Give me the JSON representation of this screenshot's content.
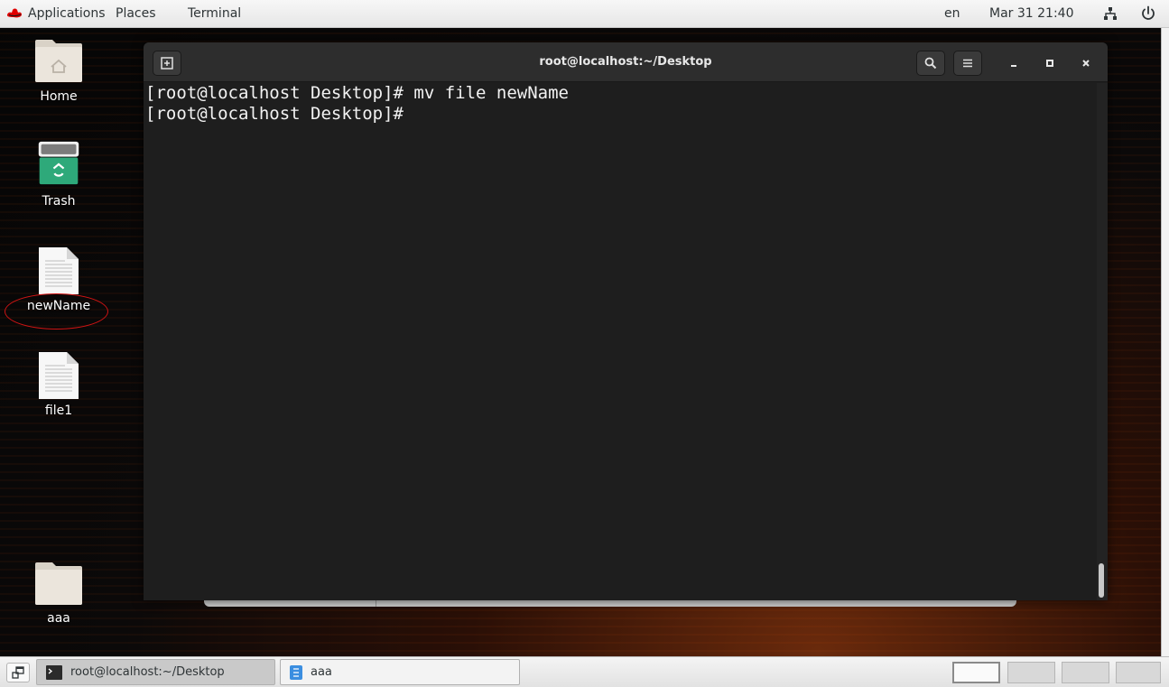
{
  "top_panel": {
    "applications": "Applications",
    "places": "Places",
    "terminal": "Terminal",
    "language": "en",
    "datetime": "Mar 31 21:40"
  },
  "desktop": {
    "icons": [
      {
        "label": "Home",
        "icon": "home-folder-icon"
      },
      {
        "label": "Trash",
        "icon": "trash-icon"
      },
      {
        "label": "newName",
        "icon": "text-file-icon"
      },
      {
        "label": "file1",
        "icon": "text-file-icon"
      },
      {
        "label": "aaa",
        "icon": "folder-icon"
      }
    ]
  },
  "terminal": {
    "title": "root@localhost:~/Desktop",
    "lines": [
      "[root@localhost Desktop]# mv file newName",
      "[root@localhost Desktop]# "
    ],
    "colors": {
      "background": "#1e1e1e",
      "titlebar": "#2d2d2d",
      "text": "#f2f2f2"
    }
  },
  "taskbar": {
    "tasks": [
      {
        "label": "root@localhost:~/Desktop",
        "icon": "terminal-icon",
        "active": true
      },
      {
        "label": "aaa",
        "icon": "file-manager-icon",
        "active": false
      }
    ],
    "workspaces": 4,
    "active_workspace": 1
  },
  "colors": {
    "highlight_circle": "#d01414",
    "redhat_red": "#e00000"
  }
}
